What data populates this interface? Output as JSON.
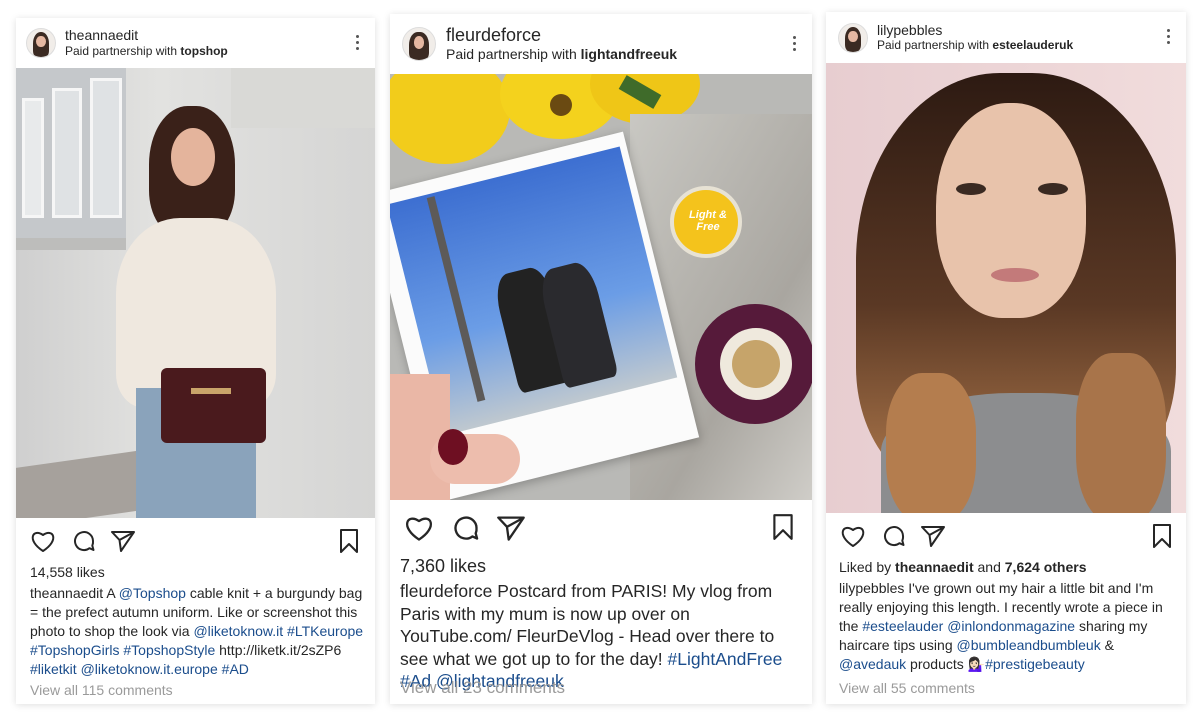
{
  "posts": [
    {
      "username": "theannaedit",
      "partnership_prefix": "Paid partnership with",
      "partner": "topshop",
      "likes": "14,558 likes",
      "caption_user": "theannaedit",
      "caption": [
        {
          "t": "A ",
          "tag": false
        },
        {
          "t": "@Topshop",
          "tag": true
        },
        {
          "t": " cable knit + a burgundy bag = the prefect autumn uniform. Like or screenshot this photo to shop the look via ",
          "tag": false
        },
        {
          "t": "@liketoknow.it",
          "tag": true
        },
        {
          "t": " ",
          "tag": false
        },
        {
          "t": "#LTKeurope",
          "tag": true
        },
        {
          "t": " ",
          "tag": false
        },
        {
          "t": "#TopshopGirls",
          "tag": true
        },
        {
          "t": " ",
          "tag": false
        },
        {
          "t": "#TopshopStyle",
          "tag": true
        },
        {
          "t": " http://liketk.it/2sZP6 ",
          "tag": false
        },
        {
          "t": "#liketkit",
          "tag": true
        },
        {
          "t": " ",
          "tag": false
        },
        {
          "t": "@liketoknow.it.europe",
          "tag": true
        },
        {
          "t": " ",
          "tag": false
        },
        {
          "t": "#AD",
          "tag": true
        }
      ],
      "view_all": "View all 115 comments"
    },
    {
      "username": "fleurdeforce",
      "partnership_prefix": "Paid partnership with",
      "partner": "lightandfreeuk",
      "likes": "7,360 likes",
      "caption_user": "fleurdeforce",
      "caption": [
        {
          "t": " Postcard from PARIS! My vlog from Paris with my mum is now up over on YouTube.com/ FleurDeVlog - Head over there to see what we got up to for the day! ",
          "tag": false
        },
        {
          "t": "#LightAndFree",
          "tag": true
        },
        {
          "t": " ",
          "tag": false
        },
        {
          "t": "#Ad",
          "tag": true
        },
        {
          "t": " ",
          "tag": false
        },
        {
          "t": "@lightandfreeuk",
          "tag": true
        }
      ],
      "view_all": "View all 23 comments",
      "product_label": "Light & Free"
    },
    {
      "username": "lilypebbles",
      "partnership_prefix": "Paid partnership with",
      "partner": "esteelauderuk",
      "liked_by_prefix": "Liked by",
      "liked_by_user": "theannaedit",
      "liked_by_and": "and",
      "liked_by_others": "7,624 others",
      "caption_user": "lilypebbles",
      "caption": [
        {
          "t": " I've grown out my hair a little bit and I'm really enjoying this length. I recently wrote a piece in the ",
          "tag": false
        },
        {
          "t": "#esteelauder",
          "tag": true
        },
        {
          "t": " ",
          "tag": false
        },
        {
          "t": "@inlondonmagazine",
          "tag": true
        },
        {
          "t": " sharing my haircare tips using ",
          "tag": false
        },
        {
          "t": "@bumbleandbumbleuk",
          "tag": true
        },
        {
          "t": " & ",
          "tag": false
        },
        {
          "t": "@avedauk",
          "tag": true
        },
        {
          "t": " products 💁🏻‍♀️",
          "tag": false
        },
        {
          "t": "#prestigebeauty",
          "tag": true
        }
      ],
      "view_all": "View all 55 comments"
    }
  ],
  "icons": {
    "like": "heart-icon",
    "comment": "comment-icon",
    "share": "send-icon",
    "save": "bookmark-icon",
    "more": "more-options-icon"
  },
  "colors": {
    "hashtag": "#1b4d8c",
    "text": "#262626",
    "muted": "#9a9a9a"
  }
}
